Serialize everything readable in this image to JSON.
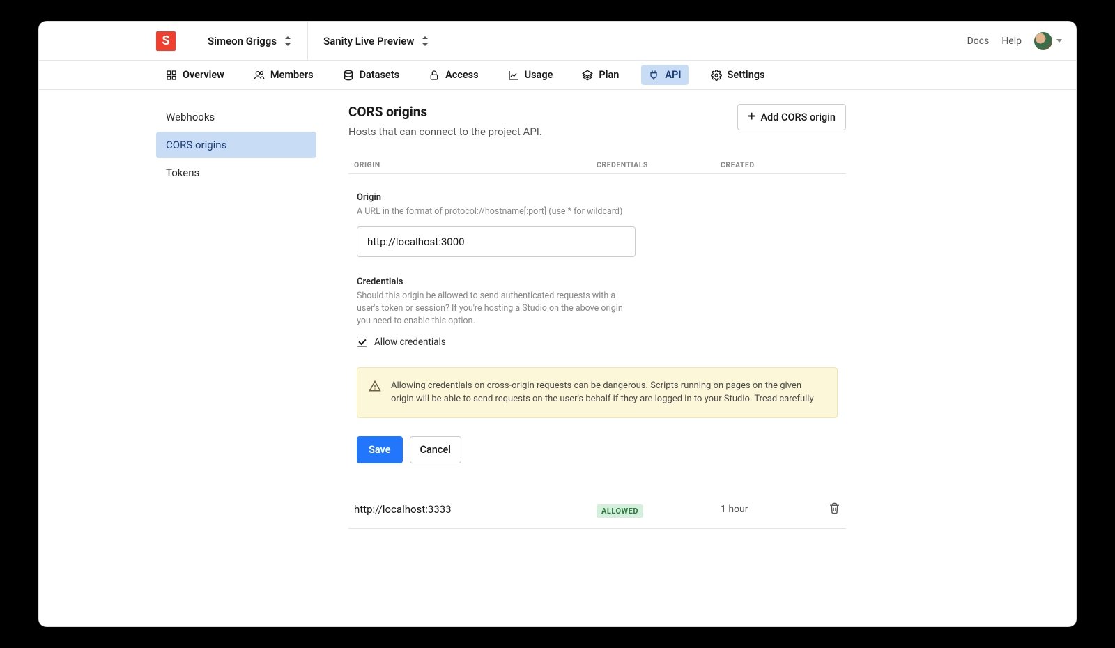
{
  "header": {
    "org_name": "Simeon Griggs",
    "project_name": "Sanity Live Preview",
    "links": {
      "docs": "Docs",
      "help": "Help"
    }
  },
  "tabs": [
    {
      "id": "overview",
      "label": "Overview"
    },
    {
      "id": "members",
      "label": "Members"
    },
    {
      "id": "datasets",
      "label": "Datasets"
    },
    {
      "id": "access",
      "label": "Access"
    },
    {
      "id": "usage",
      "label": "Usage"
    },
    {
      "id": "plan",
      "label": "Plan"
    },
    {
      "id": "api",
      "label": "API"
    },
    {
      "id": "settings",
      "label": "Settings"
    }
  ],
  "sidebar": {
    "items": [
      {
        "id": "webhooks",
        "label": "Webhooks"
      },
      {
        "id": "cors",
        "label": "CORS origins"
      },
      {
        "id": "tokens",
        "label": "Tokens"
      }
    ]
  },
  "page": {
    "title": "CORS origins",
    "description": "Hosts that can connect to the project API.",
    "add_button": "Add CORS origin",
    "columns": {
      "origin": "ORIGIN",
      "credentials": "CREDENTIALS",
      "created": "CREATED"
    }
  },
  "form": {
    "origin_label": "Origin",
    "origin_help": "A URL in the format of protocol://hostname[:port] (use * for wildcard)",
    "origin_value": "http://localhost:3000",
    "credentials_label": "Credentials",
    "credentials_help": "Should this origin be allowed to send authenticated requests with a user's token or session? If you're hosting a Studio on the above origin you need to enable this option.",
    "allow_credentials_label": "Allow credentials",
    "allow_credentials_checked": true,
    "warning": "Allowing credentials on cross-origin requests can be dangerous. Scripts running on pages on the given origin will be able to send requests on the user's behalf if they are logged in to your Studio. Tread carefully",
    "save": "Save",
    "cancel": "Cancel"
  },
  "origins": [
    {
      "origin": "http://localhost:3333",
      "credentials": "ALLOWED",
      "created": "1 hour"
    }
  ]
}
